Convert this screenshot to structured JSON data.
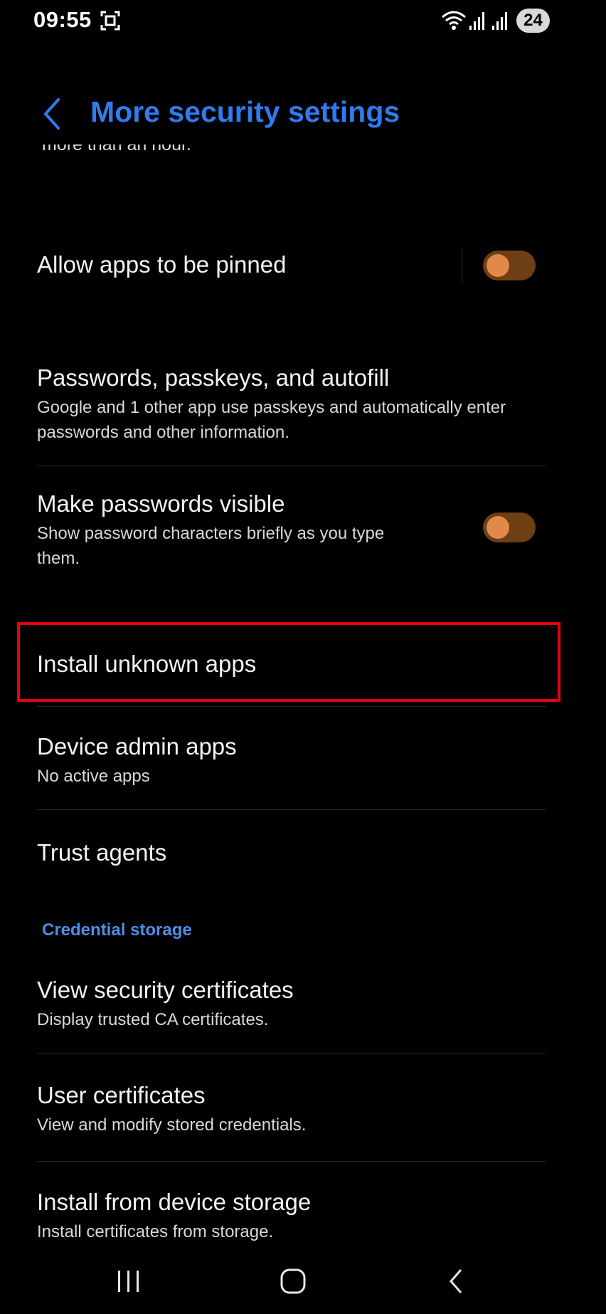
{
  "status_bar": {
    "time": "09:55",
    "battery": "24",
    "icons": [
      "screenshot-icon",
      "wifi-icon",
      "signal-icon",
      "signal-icon",
      "battery-icon"
    ]
  },
  "header": {
    "title": "More security settings",
    "back_icon": "back-arrow-icon"
  },
  "cut_off_text": "more than an hour.",
  "items": {
    "pin_apps": {
      "title": "Allow apps to be pinned",
      "toggle_on": true
    },
    "passwords_autofill": {
      "title": "Passwords, passkeys, and autofill",
      "subtitle_1": "Google and 1 other app use passkeys and automatically enter",
      "subtitle_2": "passwords and other information."
    },
    "passwords_visible": {
      "title": "Make passwords visible",
      "subtitle_1": "Show password characters briefly as you type",
      "subtitle_2": "them.",
      "toggle_on": true
    },
    "install_unknown": {
      "title": "Install unknown apps"
    },
    "device_admin": {
      "title": "Device admin apps",
      "subtitle": "No active apps"
    },
    "trust_agents": {
      "title": "Trust agents"
    },
    "view_certs": {
      "title": "View security certificates",
      "subtitle": "Display trusted CA certificates."
    },
    "user_certs": {
      "title": "User certificates",
      "subtitle": "View and modify stored credentials."
    },
    "install_storage": {
      "title": "Install from device storage",
      "subtitle": "Install certificates from storage."
    }
  },
  "section": {
    "credential_storage": "Credential storage"
  },
  "colors": {
    "accent": "#2f7bef",
    "toggle_track": "#6e3e15",
    "toggle_knob": "#e0894a",
    "highlight": "#e3000f"
  },
  "nav_bar": {
    "icons": [
      "recents-icon",
      "home-icon",
      "back-icon"
    ]
  }
}
